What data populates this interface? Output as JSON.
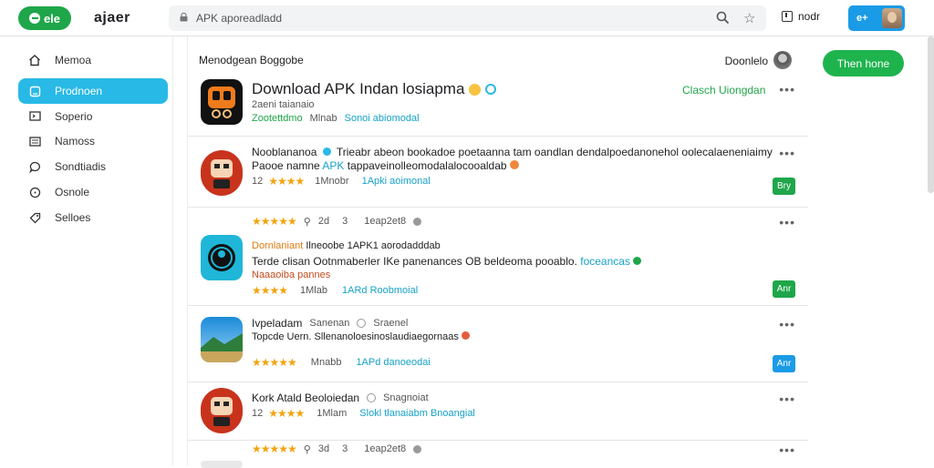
{
  "topbar": {
    "logo_label": "ele",
    "brand": "ajaer",
    "search_value": "APK aporeadladd",
    "action_label": "nodr",
    "user_label": "e+"
  },
  "sidebar": {
    "items": [
      {
        "label": "Memoa",
        "icon": "home-icon"
      },
      {
        "label": "Prodnoen",
        "icon": "square-icon"
      },
      {
        "label": "Soperio",
        "icon": "screen-icon"
      },
      {
        "label": "Namoss",
        "icon": "list-icon"
      },
      {
        "label": "Sondtiadis",
        "icon": "chat-icon"
      },
      {
        "label": "Osnole",
        "icon": "clock-icon"
      },
      {
        "label": "Selloes",
        "icon": "tag-icon"
      }
    ]
  },
  "header_card": {
    "title_small": "Menodgean Boggobe",
    "right_user": "Doonlelo",
    "title": "Download APK Indan losiapma",
    "subline": "2aeni taianaio",
    "stat_green": "Zootettdmo",
    "stat_mid": "Mlnab",
    "stat_blue": "Sonoi abiomodal",
    "link": "Clasch Uiongdan"
  },
  "cards": [
    {
      "name": "Nooblananoa",
      "desc1": "Trieabr abeon bookadoe poetaanna tam oandlan dendalpoedanonehol oolecalaeneniaimy",
      "desc2_a": "Paooe namne",
      "desc2_b": "APK",
      "desc2_c": "tappaveinolleomodalalocooaldab",
      "rating_num": "12",
      "stars": "★★★★",
      "meta": "1Mnobr",
      "blue": "1Apki aoimonal",
      "button": "Bry",
      "button_color": "#1fa64a"
    },
    {
      "top_stars": "★★★★★",
      "top_meta1": "2d",
      "top_meta2": "3",
      "top_meta3": "1eap2et8",
      "name": "Dornlaniant",
      "name_b": "Ilneoobe 1APK1 aorodadddab",
      "desc1": "Terde clisan  Ootnmaberler IKe panenances OB beldeoma pooablo.",
      "desc1_blue": "foceancas",
      "desc2": "Naaaoiba pannes",
      "stars": "★★★★",
      "meta": "1Mlab",
      "blue": "1ARd Roobmoial",
      "button": "Anr",
      "button_color": "#1fa64a"
    },
    {
      "name": "Ivpeladam",
      "name_b": "Sanenan",
      "name_c": "Sraenel",
      "desc1": "Topcde Uern. Sllenanoloesinoslaudiaegornaas",
      "stars": "★★★★★",
      "meta": "Mnabb",
      "blue": "1APd danoeodai",
      "button": "Anr",
      "button_color": "#1a9be6"
    },
    {
      "name": "Kork Atald Beoloiedan",
      "name_c": "Snagnoiat",
      "rating_num": "12",
      "stars": "★★★★",
      "meta": "1Mlam",
      "blue": "Slokl tlanaiabm Bnoangial"
    },
    {
      "top_stars": "★★★★★",
      "top_meta1": "3d",
      "top_meta2": "3",
      "top_meta3": "1eap2et8"
    }
  ],
  "rightcol": {
    "button": "Then hone"
  },
  "colors": {
    "accent_green": "#1fa64a",
    "accent_blue": "#29b9e6"
  }
}
